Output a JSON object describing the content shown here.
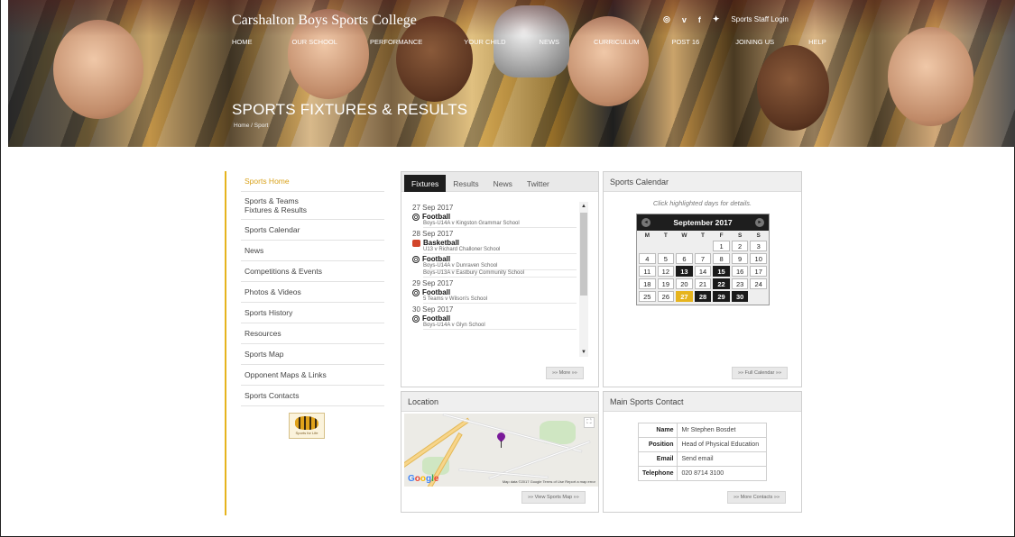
{
  "site": {
    "title": "Carshalton Boys Sports College",
    "staff_login": "Sports Staff Login",
    "page_heading": "SPORTS FIXTURES & RESULTS",
    "breadcrumb": "Home / Sport"
  },
  "topnav": [
    "HOME",
    "OUR SCHOOL",
    "PERFORMANCE",
    "YOUR CHILD",
    "NEWS",
    "CURRICULUM",
    "POST 16",
    "JOINING US",
    "HELP"
  ],
  "social": {
    "icons": [
      "instagram-icon",
      "vimeo-icon",
      "facebook-icon",
      "twitter-icon"
    ],
    "glyphs": [
      "◎",
      "v",
      "f",
      "🐦"
    ]
  },
  "sidebar": {
    "items": [
      {
        "label": "Sports Home",
        "active": true
      },
      {
        "label": "Sports & Teams\nFixtures & Results"
      },
      {
        "label": "Sports Calendar"
      },
      {
        "label": "News"
      },
      {
        "label": "Competitions & Events"
      },
      {
        "label": "Photos & Videos"
      },
      {
        "label": "Sports History"
      },
      {
        "label": "Resources"
      },
      {
        "label": "Sports Map"
      },
      {
        "label": "Opponent Maps & Links"
      },
      {
        "label": "Sports Contacts"
      }
    ],
    "badge_text": "Sports for Life"
  },
  "fixtures": {
    "tabs": [
      "Fixtures",
      "Results",
      "News",
      "Twitter"
    ],
    "more": "»» More »»",
    "days": [
      {
        "date": "27 Sep 2017",
        "entries": [
          {
            "sport": "Football",
            "icon": "football-icon",
            "matches": [
              "Boys-U14A v Kingston Grammar School"
            ]
          }
        ]
      },
      {
        "date": "28 Sep 2017",
        "entries": [
          {
            "sport": "Basketball",
            "icon": "basketball-icon",
            "matches": [
              "U13 v Richard Challoner School"
            ]
          },
          {
            "sport": "Football",
            "icon": "football-icon",
            "matches": [
              "Boys-U14A v Dunraven School",
              "Boys-U13A v Eastbury Community School"
            ]
          }
        ]
      },
      {
        "date": "29 Sep 2017",
        "entries": [
          {
            "sport": "Football",
            "icon": "football-icon",
            "matches": [
              "5 Teams v Wilson's School"
            ]
          }
        ]
      },
      {
        "date": "30 Sep 2017",
        "entries": [
          {
            "sport": "Football",
            "icon": "football-icon",
            "matches": [
              "Boys-U14A v Glyn School"
            ]
          }
        ]
      }
    ]
  },
  "calendar": {
    "title": "Sports Calendar",
    "note": "Click highlighted days for details.",
    "month": "September 2017",
    "prev": "◂",
    "next": "▸",
    "dow": [
      "M",
      "T",
      "W",
      "T",
      "F",
      "S",
      "S"
    ],
    "leading_blanks": 4,
    "days_in_month": 30,
    "highlighted": [
      13,
      15,
      22,
      28,
      29,
      30
    ],
    "today": 27,
    "full_calendar": "»» Full Calendar »»"
  },
  "location": {
    "title": "Location",
    "google": "Google",
    "map_meta": "Map data ©2017 Google   Terms of Use   Report a map error",
    "view_map": "»» View Sports Map »»"
  },
  "contact": {
    "title": "Main Sports Contact",
    "rows": [
      {
        "key": "Name",
        "value": "Mr Stephen Bosdet"
      },
      {
        "key": "Position",
        "value": "Head of Physical Education"
      },
      {
        "key": "Email",
        "value": "Send email"
      },
      {
        "key": "Telephone",
        "value": "020 8714 3100"
      }
    ],
    "more": "»» More Contacts »»"
  },
  "colors": {
    "accent": "#e6b41e",
    "dark": "#1e1e1e"
  }
}
